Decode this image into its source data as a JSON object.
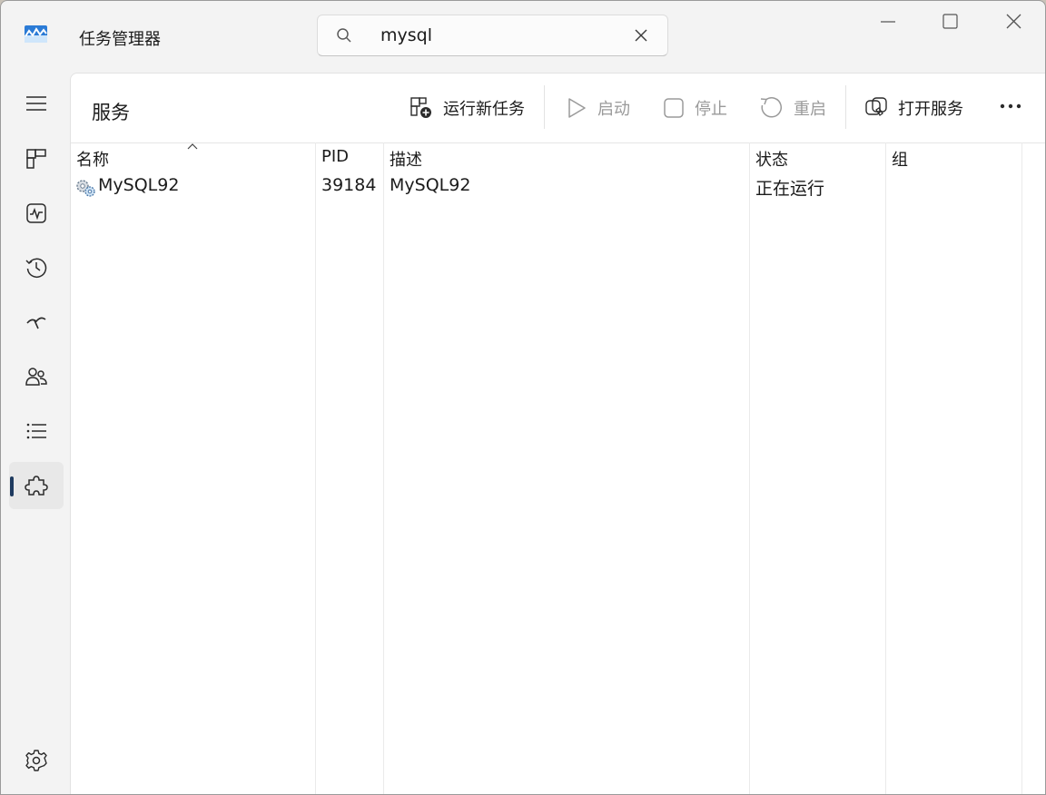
{
  "app": {
    "title": "任务管理器"
  },
  "search": {
    "value": "mysql"
  },
  "page": {
    "title": "服务"
  },
  "toolbar": {
    "run_new_task": "运行新任务",
    "start": "启动",
    "stop": "停止",
    "restart": "重启",
    "open_services": "打开服务"
  },
  "table": {
    "columns": [
      "名称",
      "PID",
      "描述",
      "状态",
      "组"
    ],
    "rows": [
      {
        "name": "MySQL92",
        "pid": "39184",
        "description": "MySQL92",
        "status": "正在运行",
        "group": ""
      }
    ]
  },
  "nav": {
    "active": "services"
  },
  "colors": {
    "accent_indicator": "#1e3a5f"
  }
}
